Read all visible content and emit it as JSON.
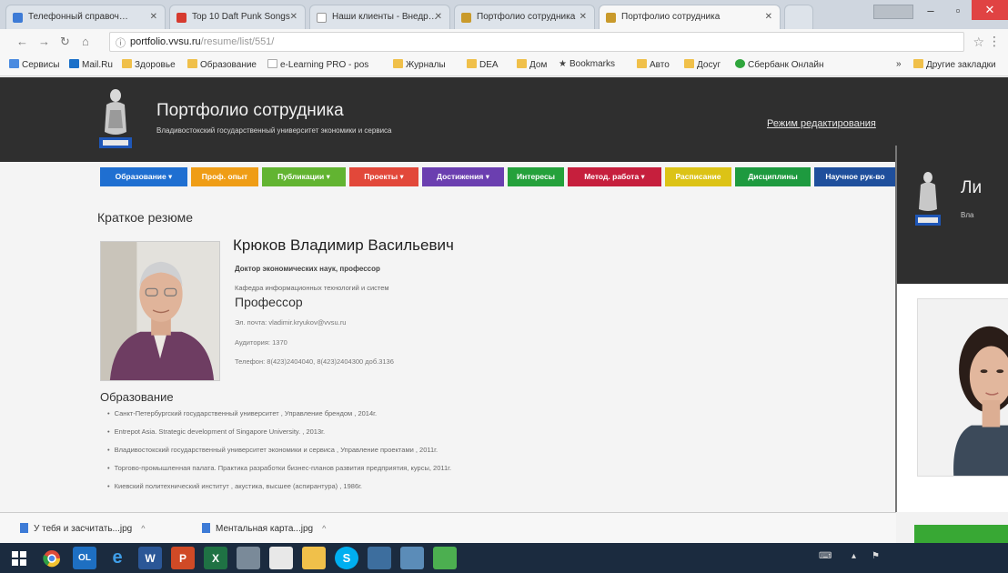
{
  "browser": {
    "tabs": [
      {
        "label": "Телефонный справоч…",
        "fav": "#3d7bd6",
        "active": false
      },
      {
        "label": "Top 10 Daft Punk Songs",
        "fav": "#d63a2f",
        "active": false
      },
      {
        "label": "Наши клиенты - Внедр…",
        "fav": "#ffffff",
        "active": false
      },
      {
        "label": "Портфолио сотрудника",
        "fav": "#c99a2b",
        "active": false
      },
      {
        "label": "Портфолио сотрудника",
        "fav": "#c99a2b",
        "active": true
      }
    ],
    "url_host": "portfolio.vvsu.ru",
    "url_path": "/resume/list/551/",
    "bookmarks": [
      {
        "label": "Сервисы",
        "type": "apps"
      },
      {
        "label": "Mail.Ru",
        "type": "mail"
      },
      {
        "label": "Здоровье",
        "type": "folder"
      },
      {
        "label": "Образование",
        "type": "folder"
      },
      {
        "label": "e-Learning PRO - pos",
        "type": "page"
      },
      {
        "label": "Журналы",
        "type": "folder"
      },
      {
        "label": "DEA",
        "type": "folder"
      },
      {
        "label": "Дом",
        "type": "folder"
      },
      {
        "label": "Bookmarks",
        "type": "star"
      },
      {
        "label": "Авто",
        "type": "folder"
      },
      {
        "label": "Досуг",
        "type": "folder"
      },
      {
        "label": "Сбербанк Онлайн",
        "type": "sber"
      },
      {
        "label": "Другие закладки",
        "type": "folder"
      }
    ]
  },
  "site": {
    "title": "Портфолио сотрудника",
    "subtitle": "Владивостокский государственный университет экономики и сервиса",
    "edit_link": "Режим редактирования",
    "menu": [
      {
        "label": "Образование ▾",
        "color": "#1f6fd1"
      },
      {
        "label": "Проф. опыт",
        "color": "#ef9d16"
      },
      {
        "label": "Публикации ▾",
        "color": "#62b431"
      },
      {
        "label": "Проекты ▾",
        "color": "#e2483a"
      },
      {
        "label": "Достижения ▾",
        "color": "#6b3fb0"
      },
      {
        "label": "Интересы",
        "color": "#25a13b"
      },
      {
        "label": "Метод. работа ▾",
        "color": "#c61f3d"
      },
      {
        "label": "Расписание",
        "color": "#dcc316"
      },
      {
        "label": "Дисциплины",
        "color": "#1e9a3f"
      },
      {
        "label": "Научное рук-во",
        "color": "#1f4f9c"
      }
    ]
  },
  "resume": {
    "heading": "Краткое резюме",
    "name": "Крюков Владимир Васильевич",
    "degree": "Доктор экономических наук, профессор",
    "department": "Кафедра информационных технологий и систем",
    "position": "Профессор",
    "email": "Эл. почта: vladimir.kryukov@vvsu.ru",
    "room": "Аудитория: 1370",
    "phone": "Телефон: 8(423)2404040, 8(423)2404300 доб.3136"
  },
  "education": {
    "heading": "Образование",
    "items": [
      "Санкт-Петербургский государственный университет , Управление брендом , 2014г.",
      "Entrepot Asia. Strategic development of Singapore University. , 2013г.",
      "Владивостокский государственный университет экономики и сервиса , Управление проектами , 2011г.",
      "Торгово-промышленная палата. Практика разработки бизнес-планов развития предприятия, курсы, 2011г.",
      "Киевский политехнический институт , акустика, высшее (аспирантура) , 1986г."
    ]
  },
  "overlay": {
    "title": "Ли",
    "subtitle": "Вла"
  },
  "downloads": [
    {
      "label": "У тебя и засчитать...jpg"
    },
    {
      "label": "Ментальная карта...jpg"
    }
  ]
}
